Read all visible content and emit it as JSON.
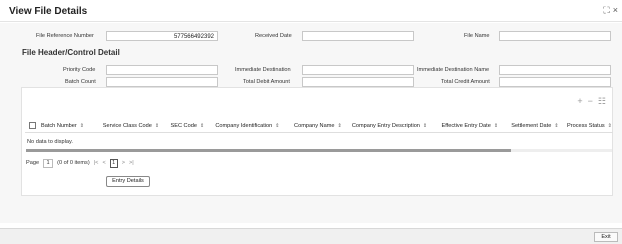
{
  "window": {
    "title": "View File Details",
    "restore_glyph": "⛶",
    "close_glyph": "×"
  },
  "file": {
    "ref_label": "File Reference Number",
    "ref_value": "577566492392",
    "received_label": "Received Date",
    "received_value": "",
    "name_label": "File Name",
    "name_value": ""
  },
  "header_section": {
    "title": "File Header/Control Detail",
    "priority_label": "Priority Code",
    "immediate_dest_label": "Immediate Destination",
    "immediate_dest_name_label": "Immediate Destination Name",
    "batch_count_label": "Batch Count",
    "total_debit_label": "Total Debit Amount",
    "total_credit_label": "Total Credit Amount"
  },
  "grid": {
    "tools": {
      "add": "+",
      "remove": "−",
      "columns": "☷"
    },
    "columns": [
      "Batch Number",
      "Service Class Code",
      "SEC Code",
      "Company Identification",
      "Company Name",
      "Company Entry Description",
      "Effective Entry Date",
      "Settlement Date",
      "Process Status"
    ],
    "sort_glyph": "⇕",
    "empty_message": "No data to display.",
    "pager": {
      "page_label": "Page",
      "page_number": "1",
      "items_text": "(0 of 0 items)",
      "first": "|<",
      "prev": "<",
      "current": "1",
      "next": ">",
      "last": ">|"
    }
  },
  "buttons": {
    "entry_details": "Entry Details",
    "exit": "Exit"
  }
}
